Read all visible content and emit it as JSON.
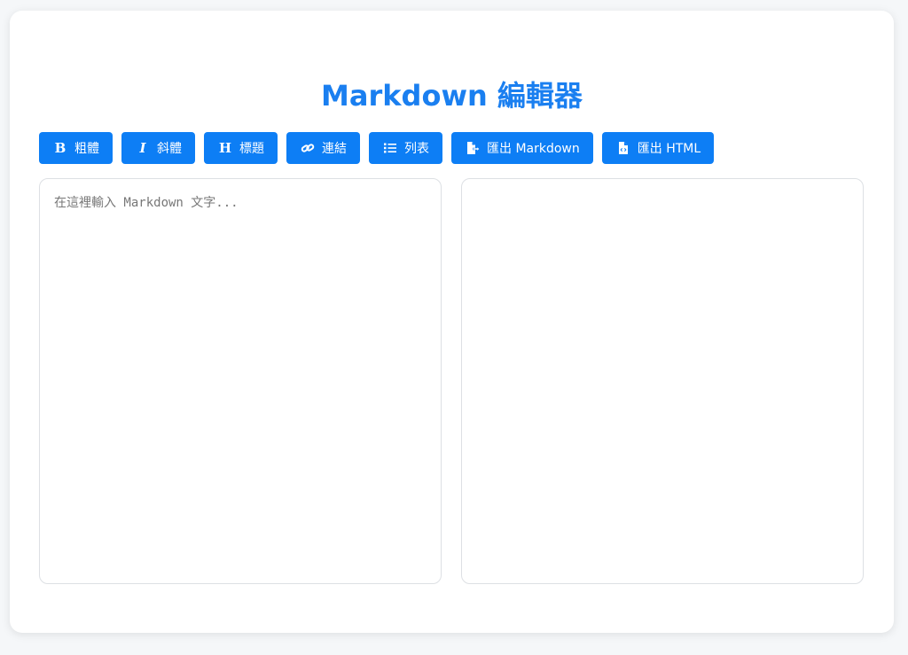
{
  "page": {
    "title": "Markdown 編輯器"
  },
  "toolbar": {
    "buttons": [
      {
        "label": "粗體",
        "icon": "bold-icon"
      },
      {
        "label": "斜體",
        "icon": "italic-icon"
      },
      {
        "label": "標題",
        "icon": "heading-icon"
      },
      {
        "label": "連結",
        "icon": "link-icon"
      },
      {
        "label": "列表",
        "icon": "list-icon"
      },
      {
        "label": "匯出 Markdown",
        "icon": "export-file-icon"
      },
      {
        "label": "匯出 HTML",
        "icon": "html-file-icon"
      }
    ]
  },
  "editor": {
    "placeholder": "在這裡輸入 Markdown 文字...",
    "value": ""
  },
  "colors": {
    "accent": "#0d7ef5",
    "title": "#1a7ff0",
    "background": "#f5f7f9",
    "card": "#ffffff"
  }
}
